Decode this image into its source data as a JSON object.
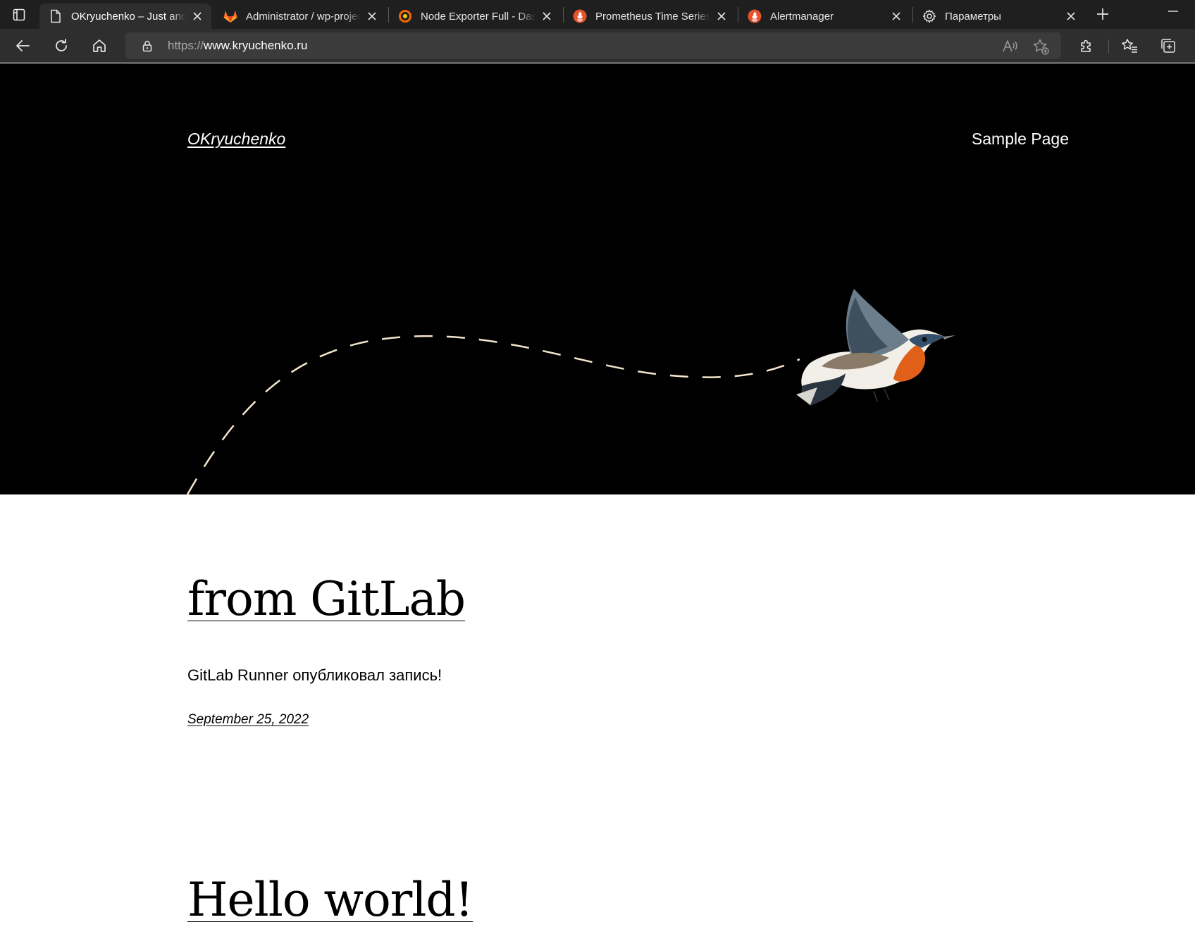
{
  "browser": {
    "tabs": [
      {
        "title": "OKryuchenko – Just another WordPress site",
        "icon": "page-icon",
        "active": true
      },
      {
        "title": "Administrator / wp-project",
        "icon": "gitlab-icon",
        "active": false
      },
      {
        "title": "Node Exporter Full - Dashboards",
        "icon": "grafana-icon",
        "active": false
      },
      {
        "title": "Prometheus Time Series Collection",
        "icon": "prometheus-icon",
        "active": false
      },
      {
        "title": "Alertmanager",
        "icon": "prometheus-icon",
        "active": false
      },
      {
        "title": "Параметры",
        "icon": "gear-icon",
        "active": false
      }
    ],
    "address": {
      "protocol": "https://",
      "host": "www.kryuchenko.ru"
    },
    "colors": {
      "tabbar": "#1f1f1f",
      "toolbar": "#2e2e2e",
      "gitlab": "#fc6d26",
      "grafana": "#f46800",
      "prometheus": "#e6522c"
    }
  },
  "site": {
    "title": "OKryuchenko",
    "nav": {
      "sample_page": "Sample Page"
    },
    "hero_colors": {
      "background": "#000000",
      "path": "#f3e5cc"
    }
  },
  "posts": [
    {
      "title": "from GitLab",
      "excerpt": "GitLab Runner опубликовал запись!",
      "date": "September 25, 2022"
    },
    {
      "title": "Hello world!"
    }
  ]
}
